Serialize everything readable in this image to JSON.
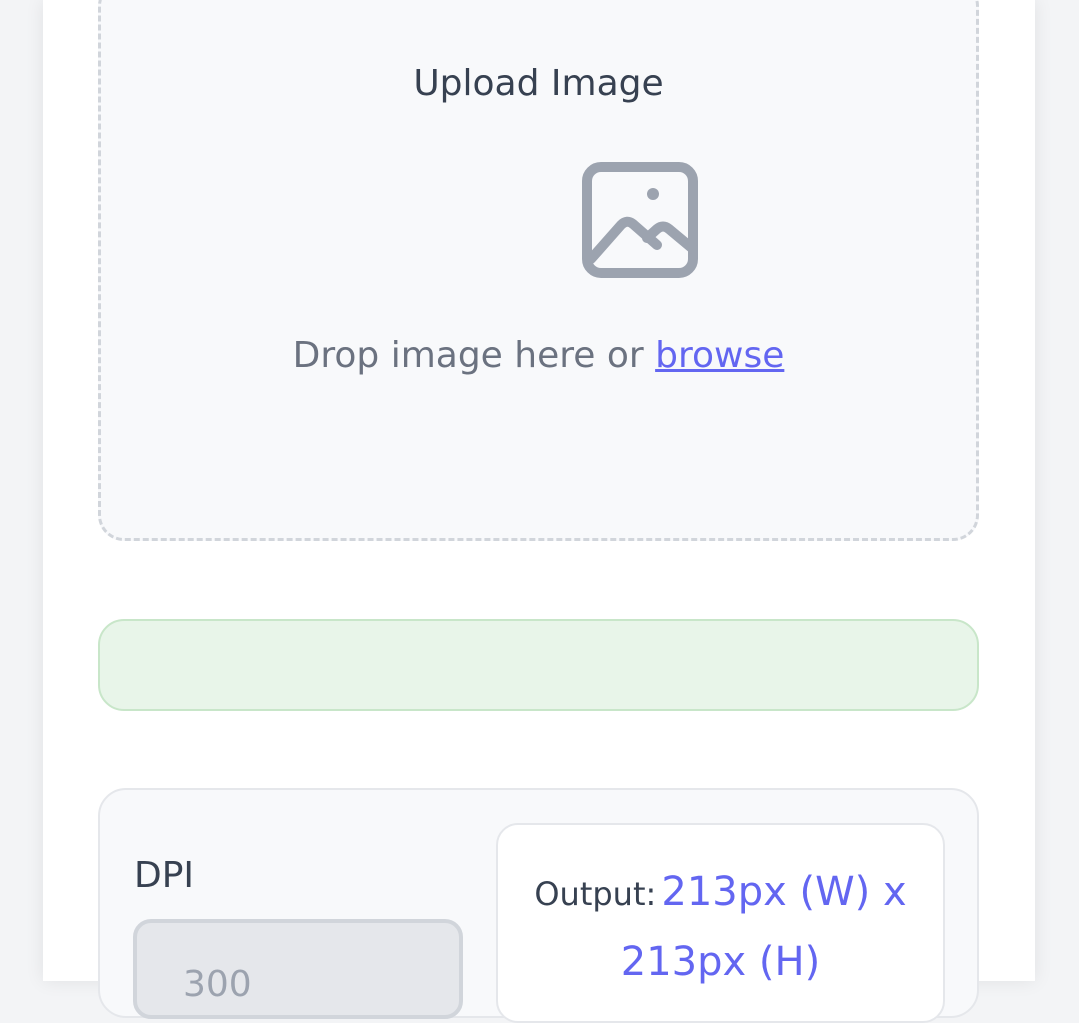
{
  "upload": {
    "title": "Upload Image",
    "drop_text": "Drop image here or ",
    "browse_label": "browse"
  },
  "status": {
    "message": ""
  },
  "settings": {
    "dpi_label": "DPI",
    "dpi_value": "300",
    "output_label": "Output:",
    "output_width": "213px (W) x",
    "output_height": "213px (H)"
  },
  "colors": {
    "accent": "#6366f1",
    "status_bg": "#e8f5e9",
    "status_border": "#c8e6c9",
    "icon": "#9ca3af"
  },
  "icons": {
    "upload": "image-icon"
  }
}
